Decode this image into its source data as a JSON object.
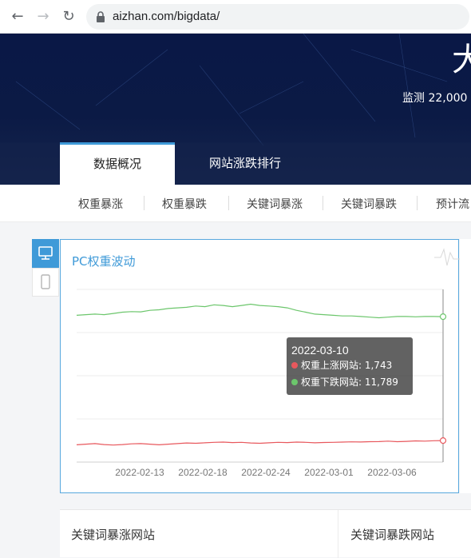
{
  "browser": {
    "url": "aizhan.com/bigdata/"
  },
  "hero": {
    "title": "大",
    "subtitle": "监测 22,000"
  },
  "tabs": [
    {
      "label": "数据概况",
      "active": true
    },
    {
      "label": "网站涨跌排行",
      "active": false
    }
  ],
  "subnav": [
    "权重暴涨",
    "权重暴跌",
    "关键词暴涨",
    "关键词暴跌",
    "预计流"
  ],
  "chart_card": {
    "title": "PC权重波动",
    "tooltip": {
      "date": "2022-03-10",
      "rows": [
        {
          "label": "权重上涨网站: 1,743",
          "color": "#e8585d"
        },
        {
          "label": "权重下跌网站: 11,789",
          "color": "#6cc66c"
        }
      ]
    }
  },
  "chart_data": {
    "type": "line",
    "x_tick_labels": [
      "2022-02-13",
      "2022-02-18",
      "2022-02-24",
      "2022-03-01",
      "2022-03-06"
    ],
    "series": [
      {
        "name": "权重下跌网站",
        "color": "#6cc66c",
        "values": [
          11900,
          11950,
          12000,
          11950,
          12050,
          12150,
          12200,
          12180,
          12300,
          12350,
          12450,
          12500,
          12550,
          12650,
          12600,
          12750,
          12700,
          12600,
          12700,
          12800,
          12700,
          12650,
          12600,
          12500,
          12300,
          12150,
          12000,
          11950,
          11900,
          11850,
          11850,
          11800,
          11750,
          11700,
          11750,
          11800,
          11800,
          11780,
          11800,
          11800,
          11789
        ]
      },
      {
        "name": "权重上涨网站",
        "color": "#e8585d",
        "values": [
          1400,
          1450,
          1500,
          1420,
          1380,
          1420,
          1480,
          1500,
          1450,
          1400,
          1450,
          1500,
          1550,
          1520,
          1560,
          1600,
          1620,
          1580,
          1600,
          1550,
          1520,
          1560,
          1600,
          1580,
          1620,
          1600,
          1560,
          1590,
          1600,
          1620,
          1640,
          1630,
          1650,
          1660,
          1700,
          1650,
          1680,
          1720,
          1700,
          1730,
          1743
        ]
      }
    ],
    "grid": true,
    "legend": "none"
  },
  "bottom": {
    "left_title": "关键词暴涨网站",
    "right_title": "关键词暴跌网站"
  }
}
